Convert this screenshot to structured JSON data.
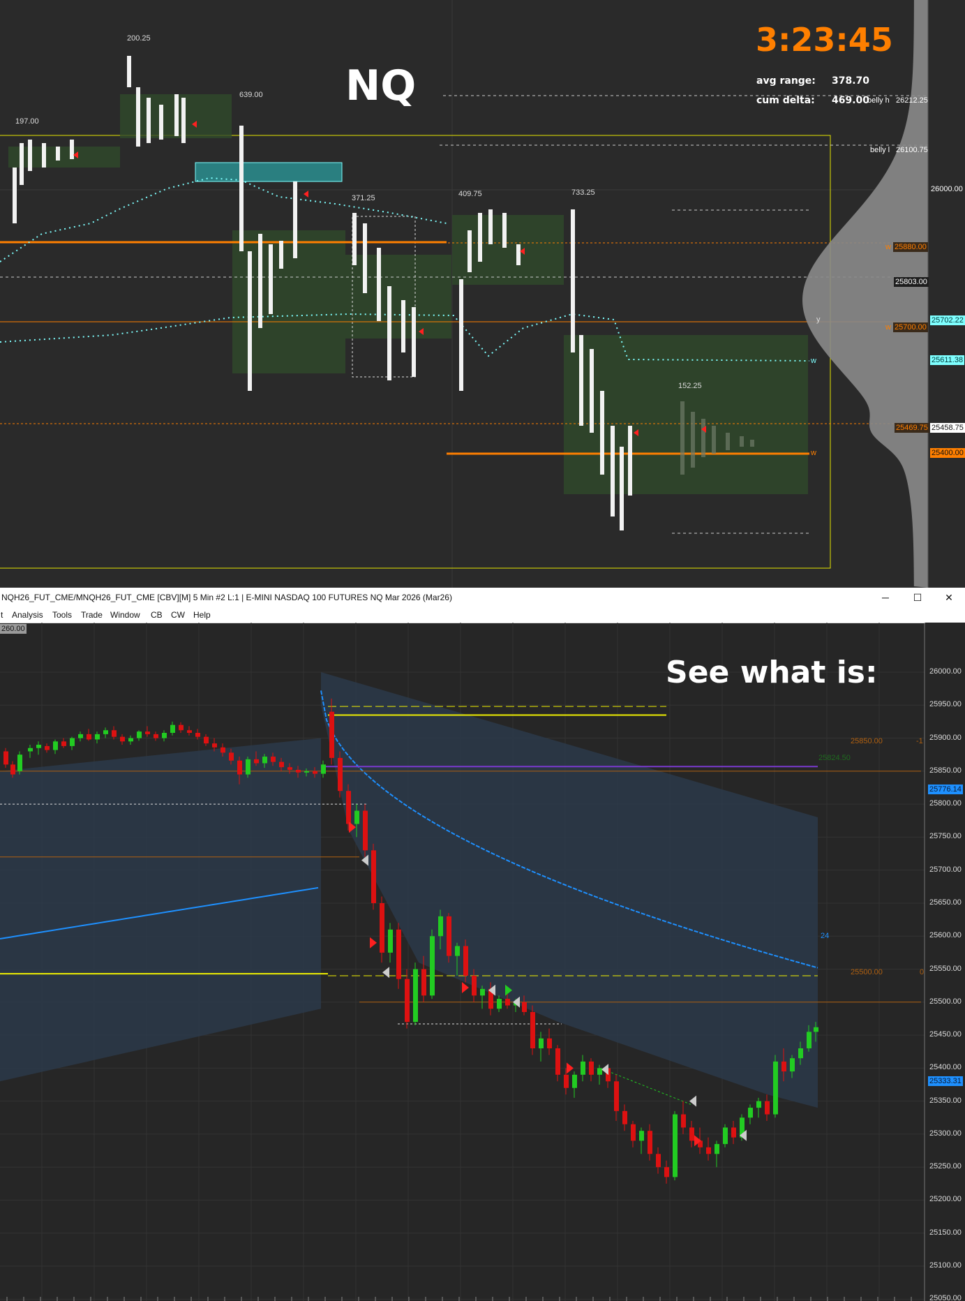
{
  "top_chart": {
    "symbol": "NQ",
    "timer": "3:23:45",
    "avg_range_label": "avg range:",
    "avg_range_value": "378.70",
    "cum_delta_label": "cum delta:",
    "cum_delta_value": "469.00",
    "bar_labels": [
      "200.25",
      "197.00",
      "639.00",
      "371.25",
      "409.75",
      "733.25",
      "152.25"
    ],
    "belly_h_label": "belly h",
    "belly_h_value": "26212.25",
    "belly_l_label": "belly l",
    "belly_l_value": "26100.75",
    "axis_26000": "26000.00",
    "w_labels": [
      "w",
      "w",
      "w",
      "w",
      "y"
    ],
    "levels": [
      {
        "price": "25880.00",
        "tag": "w"
      },
      {
        "price": "25803.00"
      },
      {
        "price": "25702.22"
      },
      {
        "price": "25700.00",
        "tag": "w"
      },
      {
        "price": "25611.38"
      },
      {
        "price": "25469.75"
      },
      {
        "price": "25458.75"
      },
      {
        "price": "25400.00"
      }
    ],
    "colors": {
      "orange": "#ff7f00",
      "cyan": "#7fffff",
      "yellow": "#e6e600",
      "green_box": "#2f4a2a"
    }
  },
  "window": {
    "title": "NQH26_FUT_CME/MNQH26_FUT_CME [CBV][M]  5 Min  #2 L:1 | E-MINI NASDAQ 100 FUTURES NQ Mar 2026 (Mar26)",
    "minimize_icon": "─",
    "maximize_icon": "☐",
    "close_icon": "✕",
    "menu": [
      "t",
      "Analysis",
      "Tools",
      "Trade",
      "Window",
      "CB",
      "CW",
      "Help"
    ],
    "corner_price": "260.00",
    "annotation": "See what is:"
  },
  "bottom_chart": {
    "y_axis_ticks": [
      "26000.00",
      "25950.00",
      "25900.00",
      "25850.00",
      "25800.00",
      "25750.00",
      "25700.00",
      "25650.00",
      "25600.00",
      "25550.00",
      "25500.00",
      "25450.00",
      "25400.00",
      "25350.00",
      "25300.00",
      "25250.00",
      "25200.00",
      "25150.00",
      "25100.00",
      "25050.00"
    ],
    "level_labels": [
      {
        "text": "25850.00",
        "side": "-1"
      },
      {
        "text": "25824.50"
      },
      {
        "text": "25500.00",
        "side": "0"
      }
    ],
    "price_boxes": [
      "25776.14",
      "25333.31"
    ],
    "vwap_tag": "24",
    "colors": {
      "up": "#22cc22",
      "down": "#dd1111",
      "vwap": "#1e90ff",
      "band": "#2c3a4a"
    }
  }
}
